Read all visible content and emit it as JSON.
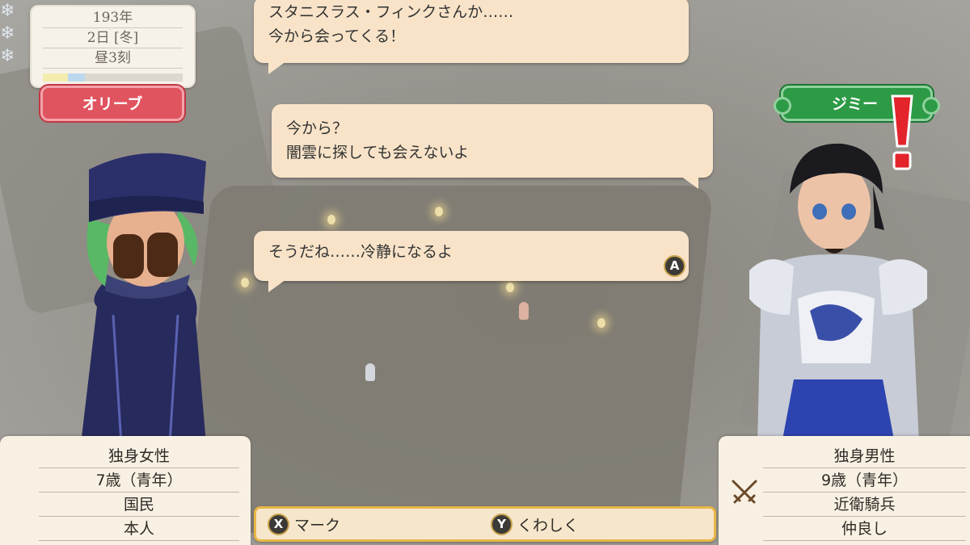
{
  "hud": {
    "year": "193年",
    "day_season": "2日 [冬]",
    "time": "昼3刻",
    "season_colors": [
      "#f3ecae",
      "#bcd8ee",
      "#dcd8d0"
    ]
  },
  "speakers": {
    "left_name": "オリーブ",
    "right_name": "ジミー",
    "left_color": "#e0545f",
    "right_color": "#2d9a46"
  },
  "dialogue": {
    "bubble1_line1": "スタニスラス・フィンクさんか……",
    "bubble1_line2": "今から会ってくる！",
    "bubble2_line1": "今から？",
    "bubble2_line2": "闇雲に探しても会えないよ",
    "bubble3_line1": "そうだね……冷静になるよ",
    "advance_button": "A"
  },
  "left_profile": {
    "status": "独身女性",
    "age": "7歳（青年）",
    "role": "国民",
    "relation": "本人"
  },
  "right_profile": {
    "status": "独身男性",
    "age": "9歳（青年）",
    "role": "近衛騎兵",
    "relation": "仲良し",
    "icon": "crossed-swords-icon"
  },
  "actions": {
    "mark_key": "X",
    "mark_label": "マーク",
    "detail_key": "Y",
    "detail_label": "くわしく"
  },
  "colors": {
    "bubble": "#f8e3c8",
    "panel": "#f8f1e3",
    "action_border": "#e9b645"
  }
}
